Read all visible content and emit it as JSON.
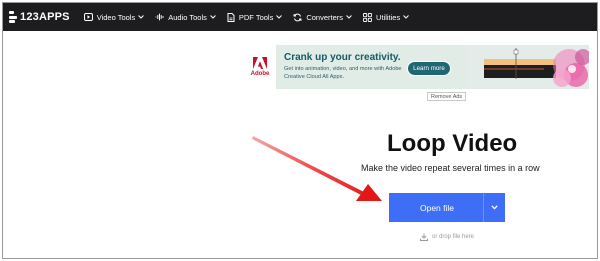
{
  "brand": {
    "name": "123APPS"
  },
  "nav": {
    "items": [
      {
        "label": "Video Tools",
        "icon": "video-icon"
      },
      {
        "label": "Audio Tools",
        "icon": "audio-wave-icon"
      },
      {
        "label": "PDF Tools",
        "icon": "pdf-icon"
      },
      {
        "label": "Converters",
        "icon": "convert-icon"
      },
      {
        "label": "Utilities",
        "icon": "utilities-icon"
      }
    ]
  },
  "ad": {
    "brand": "Adobe",
    "headline": "Crank up your creativity.",
    "body": "Get into animation, video, and more with Adobe Creative Cloud All Apps.",
    "cta": "Learn more",
    "remove_ads": "Remove Ads"
  },
  "hero": {
    "title": "Loop Video",
    "subtitle": "Make the video repeat several times in a row"
  },
  "upload": {
    "button_label": "Open file",
    "drop_hint": "or drop file here"
  },
  "colors": {
    "topbar": "#1d1d1f",
    "primary_button": "#3d6ef5",
    "annotation_arrow": "#e02020",
    "ad_background": "#e2ece7"
  }
}
